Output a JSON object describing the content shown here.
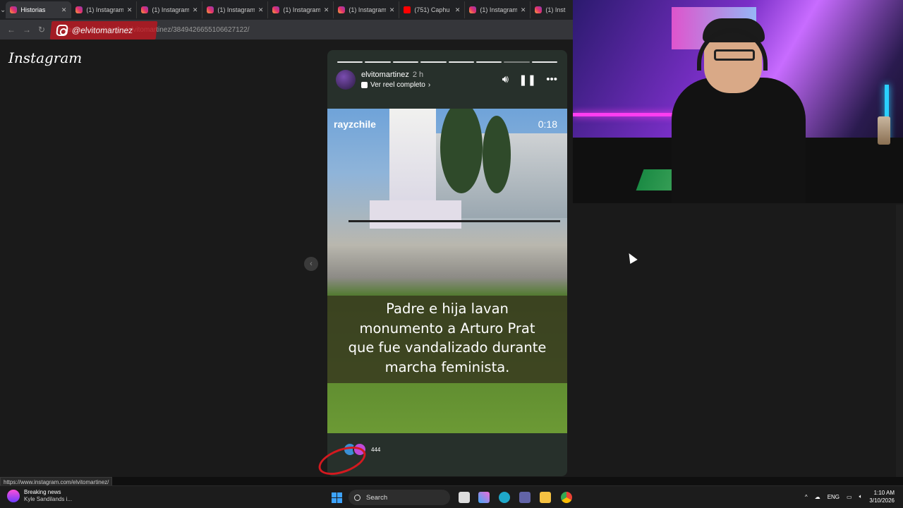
{
  "browser": {
    "tabs": [
      {
        "label": "Historias",
        "active": true
      },
      {
        "label": "(1) Instagram"
      },
      {
        "label": "(1) Instagram"
      },
      {
        "label": "(1) Instagram"
      },
      {
        "label": "(1) Instagram"
      },
      {
        "label": "(1) Instagram"
      },
      {
        "label": "(751) Caphu",
        "youtube": true
      },
      {
        "label": "(1) Instagram"
      },
      {
        "label": "(1) Inst"
      }
    ],
    "url": "instagram.com/stories/elvitomartinez/3849426655106627122/",
    "overlay_handle": "@elvitomartinez"
  },
  "page": {
    "logo": "Instagram"
  },
  "story": {
    "username": "elvitomartinez",
    "time_ago": "2 h",
    "reel_link": "Ver reel completo",
    "progress_total": 8,
    "progress_current": 7,
    "video": {
      "source": "rayzchile",
      "timestamp": "0:18",
      "caption_lines": [
        "Padre e hija lavan",
        "monumento a Arturo Prat",
        "que fue vandalizado durante",
        "marcha feminista."
      ]
    },
    "viewer_count": "444"
  },
  "status_bar": {
    "hover_url": "https://www.instagram.com/elvitomartinez/"
  },
  "taskbar": {
    "news_title": "Breaking news",
    "news_sub": "Kyle Sandilands i...",
    "search_label": "Search",
    "language": "ENG",
    "time": "1:10 AM",
    "date": "3/10/2026"
  },
  "colors": {
    "ig_gradient": "#e1306c",
    "overlay_red": "#c8141e",
    "windows_blue": "#3ca3ff"
  }
}
